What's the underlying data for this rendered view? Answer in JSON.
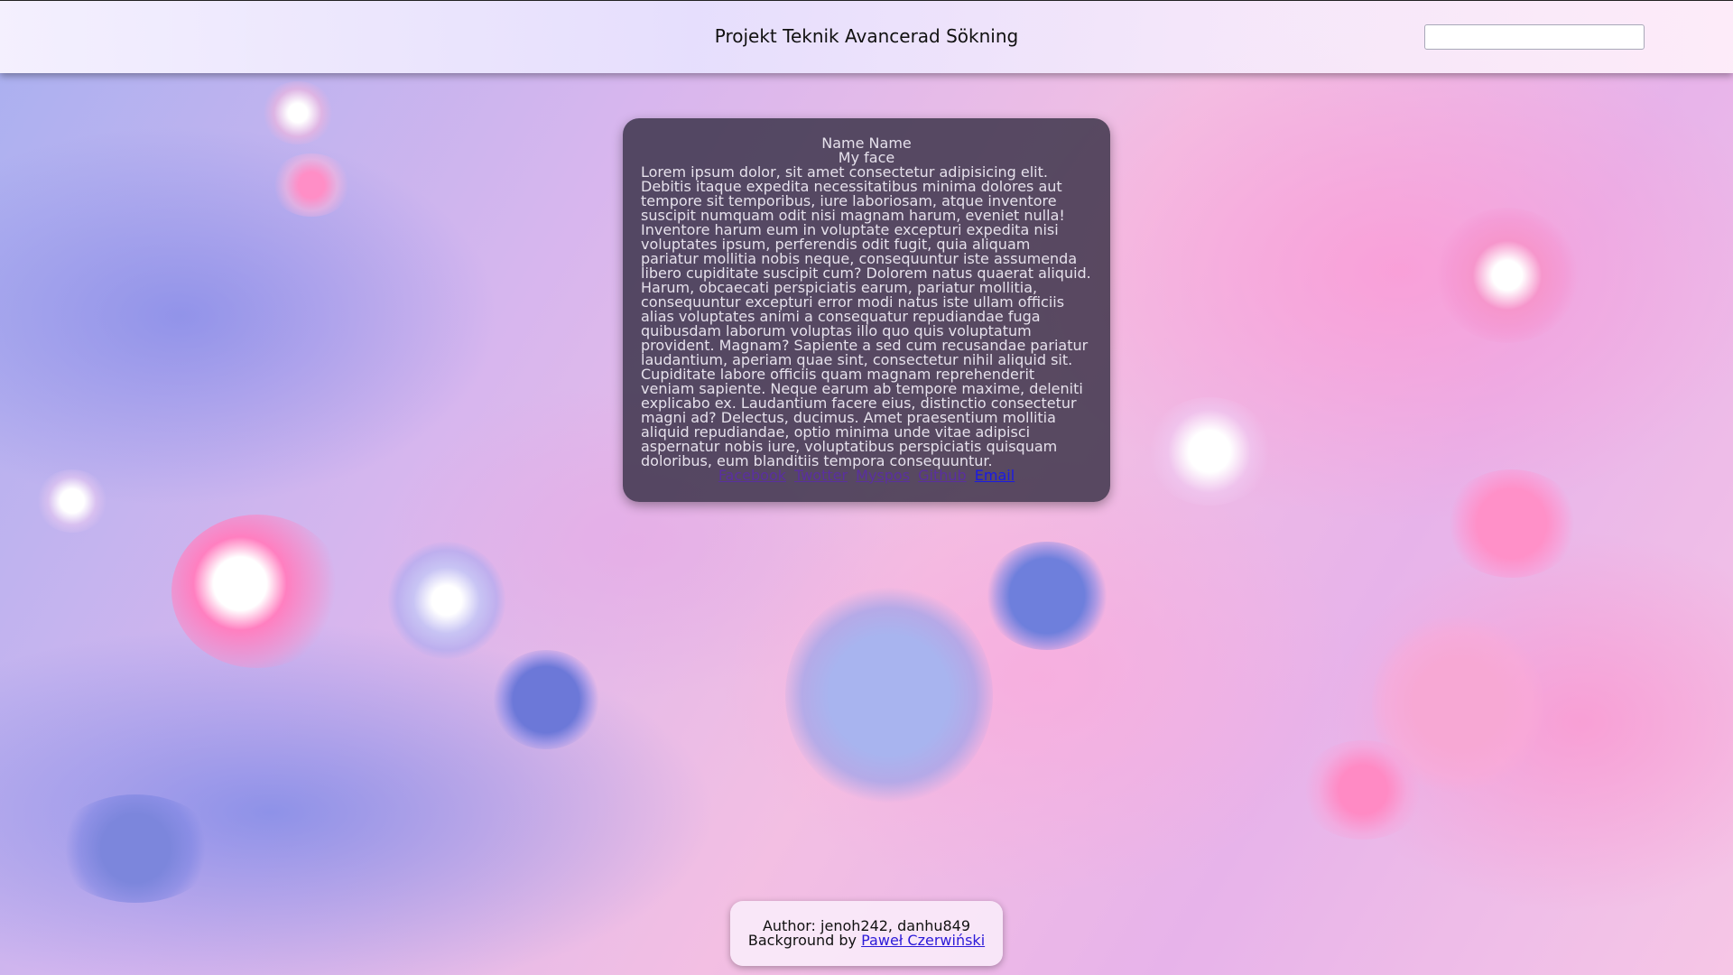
{
  "header": {
    "title": "Projekt Teknik Avancerad Sökning",
    "search_value": "",
    "search_placeholder": ""
  },
  "card": {
    "name": "Name Name",
    "image_alt": "My face",
    "bio": "Lorem ipsum dolor, sit amet consectetur adipisicing elit. Debitis itaque expedita necessitatibus minima dolores aut tempore sit temporibus, iure laboriosam, atque inventore suscipit numquam odit nisi magnam harum, eveniet nulla! Inventore harum eum in voluptate excepturi expedita nisi voluptates ipsum, perferendis odit fugit, quia aliquam pariatur mollitia nobis neque, consequuntur iste assumenda libero cupiditate suscipit cum? Dolorem natus quaerat aliquid. Harum, obcaecati perspiciatis earum, pariatur mollitia, consequuntur excepturi error modi natus iste ullam officiis alias voluptates animi a consequatur repudiandae fuga quibusdam laborum voluptas illo quo quis voluptatum provident. Magnam? Sapiente a sed cum recusandae pariatur laudantium, aperiam quae sint, consectetur nihil aliquid sit. Cupiditate labore officiis quam magnam reprehenderit veniam sapiente. Neque earum ab tempore maxime, deleniti explicabo ex. Laudantium facere eius, distinctio consectetur magni ad? Delectus, ducimus. Amet praesentium mollitia aliquid repudiandae, optio minima unde vitae adipisci aspernatur nobis iure, voluptatibus perspiciatis quisquam doloribus, eum blanditiis tempora consequuntur.",
    "links": {
      "facebook": "Facebook",
      "twitter": "Twotter",
      "myspace": "Myspos",
      "github": "Github",
      "email": "Email"
    }
  },
  "footer": {
    "author_line": "Author: jenoh242, danhu849",
    "background_prefix": "Background by",
    "background_credit": "Paweł Czerwiński"
  },
  "colors": {
    "card_bg": "#2d283c",
    "visited_link": "#5a2fa0",
    "link": "#1a1ae6"
  }
}
